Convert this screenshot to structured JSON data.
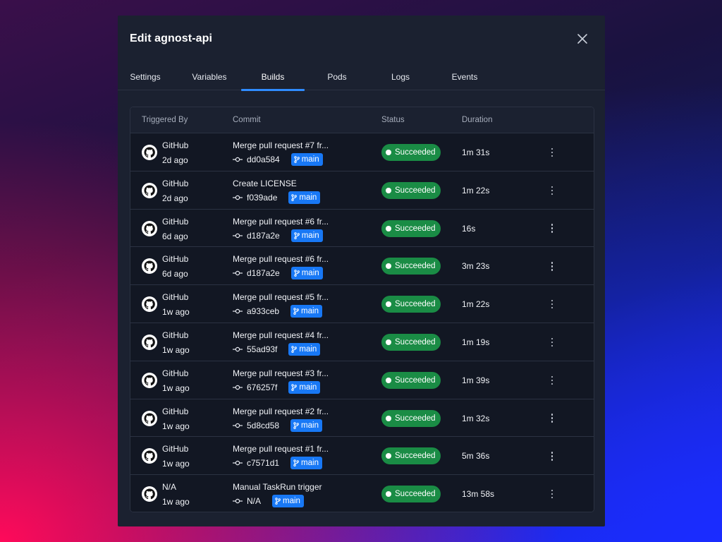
{
  "modal": {
    "title": "Edit agnost-api"
  },
  "tabs": [
    {
      "label": "Settings"
    },
    {
      "label": "Variables"
    },
    {
      "label": "Builds"
    },
    {
      "label": "Pods"
    },
    {
      "label": "Logs"
    },
    {
      "label": "Events"
    }
  ],
  "active_tab": "Builds",
  "table": {
    "headers": {
      "triggered_by": "Triggered By",
      "commit": "Commit",
      "status": "Status",
      "duration": "Duration"
    },
    "rows": [
      {
        "trigger": "GitHub",
        "time": "2d ago",
        "message": "Merge pull request #7 fr...",
        "sha": "dd0a584",
        "branch": "main",
        "status": "Succeeded",
        "duration": "1m 31s"
      },
      {
        "trigger": "GitHub",
        "time": "2d ago",
        "message": "Create LICENSE",
        "sha": "f039ade",
        "branch": "main",
        "status": "Succeeded",
        "duration": "1m 22s"
      },
      {
        "trigger": "GitHub",
        "time": "6d ago",
        "message": "Merge pull request #6 fr...",
        "sha": "d187a2e",
        "branch": "main",
        "status": "Succeeded",
        "duration": "16s"
      },
      {
        "trigger": "GitHub",
        "time": "6d ago",
        "message": "Merge pull request #6 fr...",
        "sha": "d187a2e",
        "branch": "main",
        "status": "Succeeded",
        "duration": "3m 23s"
      },
      {
        "trigger": "GitHub",
        "time": "1w ago",
        "message": "Merge pull request #5 fr...",
        "sha": "a933ceb",
        "branch": "main",
        "status": "Succeeded",
        "duration": "1m 22s"
      },
      {
        "trigger": "GitHub",
        "time": "1w ago",
        "message": "Merge pull request #4 fr...",
        "sha": "55ad93f",
        "branch": "main",
        "status": "Succeeded",
        "duration": "1m 19s"
      },
      {
        "trigger": "GitHub",
        "time": "1w ago",
        "message": "Merge pull request #3 fr...",
        "sha": "676257f",
        "branch": "main",
        "status": "Succeeded",
        "duration": "1m 39s"
      },
      {
        "trigger": "GitHub",
        "time": "1w ago",
        "message": "Merge pull request #2 fr...",
        "sha": "5d8cd58",
        "branch": "main",
        "status": "Succeeded",
        "duration": "1m 32s"
      },
      {
        "trigger": "GitHub",
        "time": "1w ago",
        "message": "Merge pull request #1 fr...",
        "sha": "c7571d1",
        "branch": "main",
        "status": "Succeeded",
        "duration": "5m 36s"
      },
      {
        "trigger": "N/A",
        "time": "1w ago",
        "message": "Manual TaskRun trigger",
        "sha": "N/A",
        "branch": "main",
        "status": "Succeeded",
        "duration": "13m 58s"
      }
    ]
  },
  "colors": {
    "accent": "#2f8cff",
    "branch_badge": "#1878f5",
    "status_success": "#1a8c45",
    "modal_bg": "#1b2130"
  },
  "icons": {
    "close": "close-icon",
    "trigger_avatar": "github-icon",
    "commit": "git-commit-icon",
    "branch": "git-branch-icon",
    "row_menu": "more-vertical-icon"
  }
}
